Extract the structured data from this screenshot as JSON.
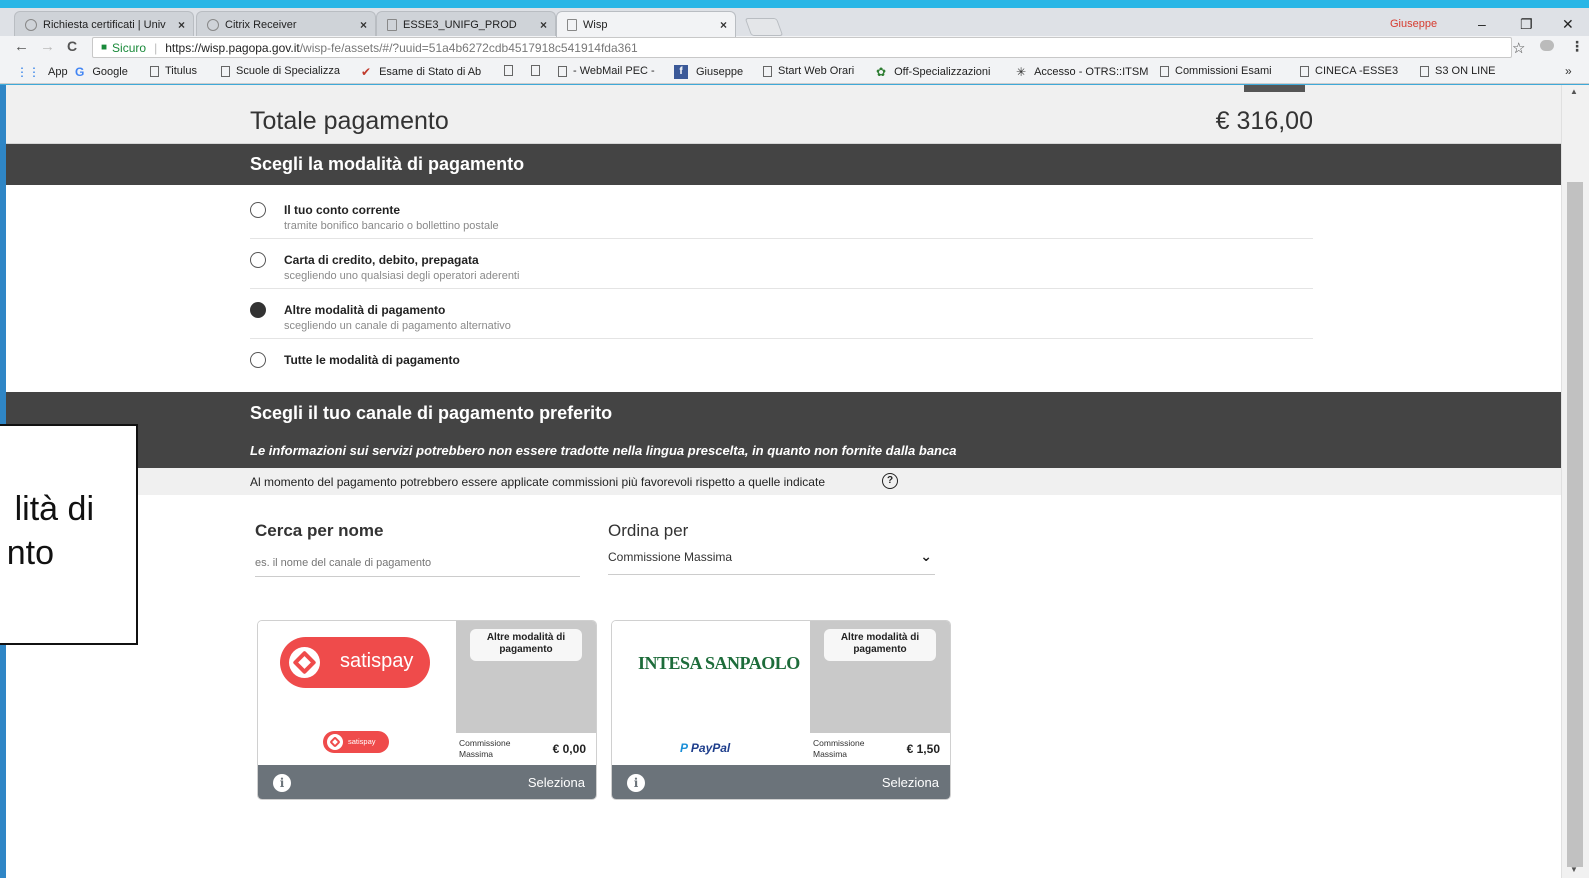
{
  "tabs": [
    {
      "label": "Richiesta certificati | Univ",
      "close": "×",
      "active": false
    },
    {
      "label": "Citrix Receiver",
      "close": "×",
      "active": false
    },
    {
      "label": "ESSE3_UNIFG_PROD",
      "close": "×",
      "active": false
    },
    {
      "label": "Wisp",
      "close": "×",
      "active": true
    }
  ],
  "window": {
    "profile": "Giuseppe",
    "minimize": "–",
    "restore": "❐",
    "close": "✕"
  },
  "toolbar": {
    "back": "←",
    "forward": "→",
    "reload": "C",
    "secure_label": "Sicuro",
    "url_host": "https://wisp.pagopa.gov.it",
    "url_path": "/wisp-fe/assets/#/?uuid=51a4b6272cdb4517918c541914fda361",
    "star": "☆",
    "menu": "⋮"
  },
  "bookmarks": [
    {
      "label": "App",
      "icon": "apps-icon"
    },
    {
      "label": "Google",
      "icon": "google-icon"
    },
    {
      "label": "Titulus",
      "icon": "page-icon"
    },
    {
      "label": "Scuole di Specializza",
      "icon": "page-icon"
    },
    {
      "label": "Esame di Stato di Ab",
      "icon": "esame-icon"
    },
    {
      "label": "",
      "icon": "page-icon"
    },
    {
      "label": "",
      "icon": "page-icon"
    },
    {
      "label": "- WebMail PEC -",
      "icon": "page-icon"
    },
    {
      "label": "Giuseppe",
      "icon": "facebook-icon"
    },
    {
      "label": "Start Web Orari",
      "icon": "page-icon"
    },
    {
      "label": "Off-Specializzazioni",
      "icon": "off-icon"
    },
    {
      "label": "Accesso - OTRS::ITSM",
      "icon": "otrs-icon"
    },
    {
      "label": "Commissioni Esami",
      "icon": "page-icon"
    },
    {
      "label": "CINECA -ESSE3",
      "icon": "page-icon"
    },
    {
      "label": "S3 ON LINE",
      "icon": "page-icon"
    }
  ],
  "bookmarks_more": "»",
  "totale": {
    "label": "Totale pagamento",
    "value": "€ 316,00"
  },
  "modalita": {
    "title": "Scegli la modalità di pagamento",
    "options": [
      {
        "title": "Il tuo conto corrente",
        "subtitle": "tramite bonifico bancario o bollettino postale",
        "selected": false
      },
      {
        "title": "Carta di credito, debito, prepagata",
        "subtitle": "scegliendo uno qualsiasi degli operatori aderenti",
        "selected": false
      },
      {
        "title": "Altre modalità di pagamento",
        "subtitle": "scegliendo un canale di pagamento alternativo",
        "selected": true
      },
      {
        "title": "Tutte le modalità di pagamento",
        "subtitle": "",
        "selected": false
      }
    ]
  },
  "canale": {
    "title": "Scegli il tuo canale di pagamento preferito",
    "note": "Le informazioni sui servizi potrebbero non essere tradotte nella lingua prescelta, in quanto non fornite dalla banca",
    "commission_note": "Al momento del pagamento potrebbero essere applicate commissioni più favorevoli rispetto a quelle indicate",
    "help": "?"
  },
  "search": {
    "label": "Cerca per nome",
    "placeholder": "es. il nome del canale di pagamento"
  },
  "sort": {
    "label": "Ordina per",
    "value": "Commissione Massima",
    "chevron": "⌄"
  },
  "cards": [
    {
      "bank": "satispay",
      "service_logo": "satispay",
      "category": "Altre modalità di pagamento",
      "fee_label": "Commissione Massima",
      "fee": "€ 0,00",
      "select": "Seleziona",
      "info": "i"
    },
    {
      "bank": "INTESA SANPAOLO",
      "service_logo": "PayPal",
      "category": "Altre modalità di pagamento",
      "fee_label": "Commissione Massima",
      "fee": "€ 1,50",
      "select": "Seleziona",
      "info": "i"
    }
  ],
  "overlay": {
    "line1": "lità di",
    "line2": "nto"
  },
  "colors": {
    "dark_band": "#444444",
    "card_footer": "#6b737a",
    "satispay_red": "#ef4b4b",
    "intesa_green": "#1d6c3a"
  }
}
